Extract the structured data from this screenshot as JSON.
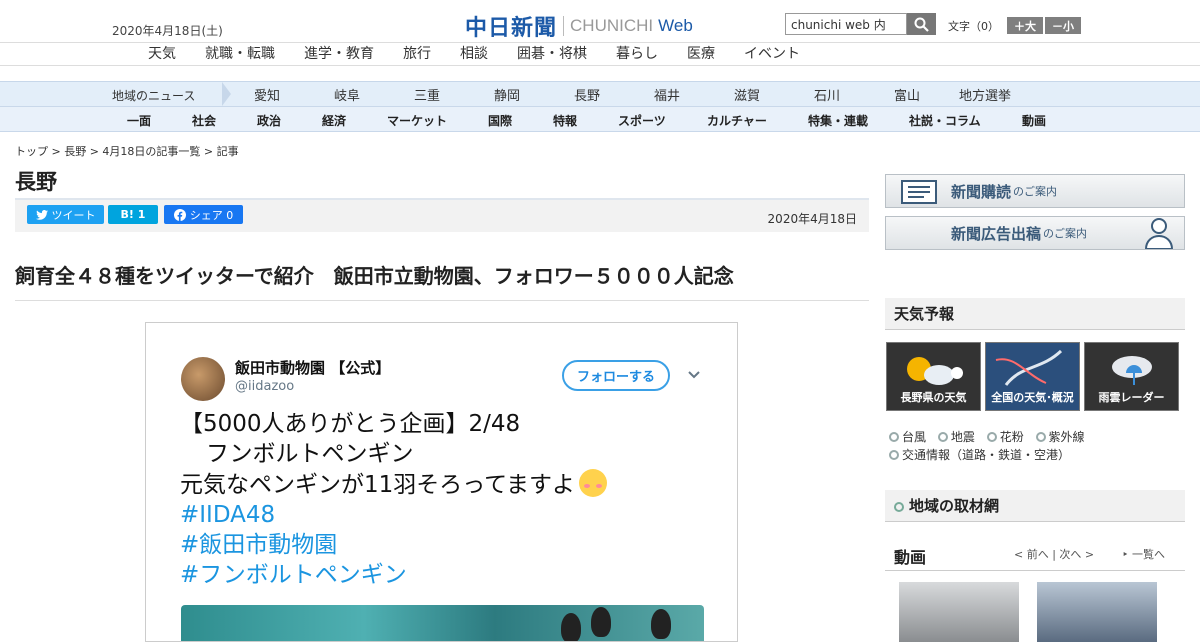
{
  "header": {
    "date": "2020年4月18日(土)",
    "logo_jp": "中日新聞",
    "logo_en": "CHUNICHI",
    "logo_web": "Web",
    "search_value": "chunichi web 内",
    "fontsize_label": "文字（0）",
    "font_larger": "＋大",
    "font_smaller": "－小"
  },
  "category_nav": [
    "天気",
    "就職・転職",
    "進学・教育",
    "旅行",
    "相談",
    "囲碁・将棋",
    "暮らし",
    "医療",
    "イベント"
  ],
  "region_nav": {
    "heading": "地域のニュース",
    "items": [
      "愛知",
      "岐阜",
      "三重",
      "静岡",
      "長野",
      "福井",
      "滋賀",
      "石川",
      "富山",
      "地方選挙"
    ]
  },
  "section_nav": [
    "一面",
    "社会",
    "政治",
    "経済",
    "マーケット",
    "国際",
    "特報",
    "スポーツ",
    "カルチャー",
    "特集・連載",
    "社説・コラム",
    "動画"
  ],
  "breadcrumb": "トップ > 長野 > 4月18日の記事一覧 > 記事",
  "pref_title": "長野",
  "share": {
    "tweet": "ツイート",
    "hatena": "B! 1",
    "facebook": "シェア 0",
    "date": "2020年4月18日"
  },
  "headline": "飼育全４８種をツイッターで紹介　飯田市立動物園、フォロワー５０００人記念",
  "tweet": {
    "account_name": "飯田市動物園 【公式】",
    "handle": "@iidazoo",
    "follow": "フォローする",
    "line1": "【5000人ありがとう企画】2/48",
    "line2": "フンボルトペンギン",
    "line3": "元気なペンギンが11羽そろってますよ",
    "tag1": "#IIDA48",
    "tag2": "#飯田市動物園",
    "tag3": "#フンボルトペンギン"
  },
  "sidebar": {
    "ad1_main": "新聞購読",
    "ad1_sub": "のご案内",
    "ad2_main": "新聞広告出稿",
    "ad2_sub": "のご案内",
    "weather_title": "天気予報",
    "weather_tiles": [
      "長野県の天気",
      "全国の天気･概況",
      "雨雲レーダー"
    ],
    "weather_links": [
      "台風",
      "地震",
      "花粉",
      "紫外線"
    ],
    "traffic_link": "交通情報（道路・鉄道・空港）",
    "reports_title": "地域の取材網",
    "video_title": "動画",
    "video_nav": "< 前へ | 次へ >",
    "video_more": "‣ 一覧へ"
  }
}
